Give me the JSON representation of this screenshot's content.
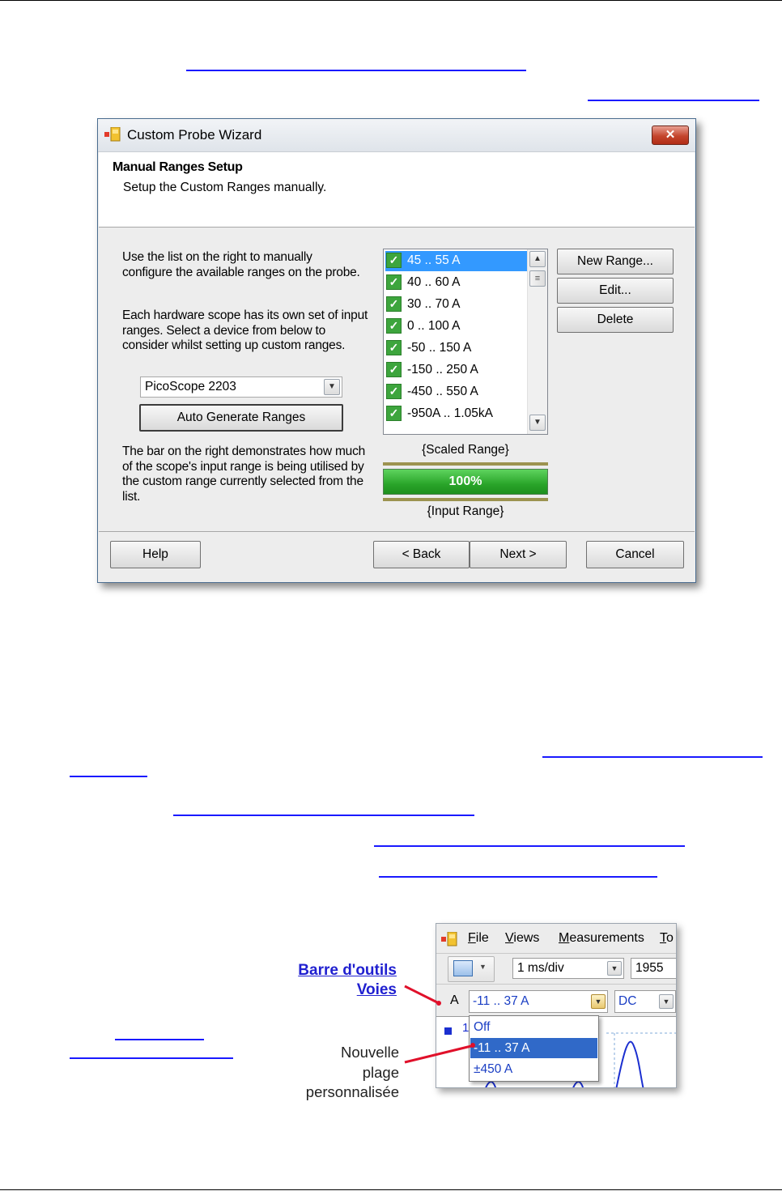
{
  "wizard": {
    "title": "Custom Probe Wizard",
    "close_label": "✕",
    "header_title": "Manual Ranges Setup",
    "header_subtitle": "Setup the Custom Ranges manually.",
    "instructions_1": "Use the list on the right to manually configure the available ranges on the probe.",
    "instructions_2": "Each hardware scope has its own set of input ranges. Select a device from below to consider whilst setting up custom ranges.",
    "device_selected": "PicoScope 2203",
    "auto_generate_label": "Auto Generate Ranges",
    "instructions_3": "The bar on the right demonstrates how much of the scope's input range is being utilised by the custom range currently selected from the list.",
    "ranges": [
      {
        "label": "45 .. 55 A",
        "checked": true,
        "selected": true
      },
      {
        "label": "40 .. 60 A",
        "checked": true,
        "selected": false
      },
      {
        "label": "30 .. 70 A",
        "checked": true,
        "selected": false
      },
      {
        "label": "0 .. 100 A",
        "checked": true,
        "selected": false
      },
      {
        "label": "-50 .. 150 A",
        "checked": true,
        "selected": false
      },
      {
        "label": "-150 .. 250 A",
        "checked": true,
        "selected": false
      },
      {
        "label": "-450 .. 550 A",
        "checked": true,
        "selected": false
      },
      {
        "label": "-950A .. 1.05kA",
        "checked": true,
        "selected": false
      }
    ],
    "new_range_label": "New Range...",
    "edit_label": "Edit...",
    "delete_label": "Delete",
    "scaled_range_label": "{Scaled Range}",
    "utilisation_text": "100%",
    "utilisation_value": 1.0,
    "input_range_label": "{Input Range}",
    "help_label": "Help",
    "back_label": "< Back",
    "next_label": "Next >",
    "cancel_label": "Cancel"
  },
  "picoscope": {
    "menu": [
      {
        "underline": "F",
        "rest": "ile"
      },
      {
        "underline": "V",
        "rest": "iews"
      },
      {
        "underline": "M",
        "rest": "easurements"
      },
      {
        "underline": "T",
        "rest": "o"
      }
    ],
    "timebase": "1 ms/div",
    "samples": "1955",
    "channel_letter": "A",
    "range_selected": "-11 .. 37 A",
    "coupling": "DC",
    "range_options": [
      "Off",
      "-11 .. 37 A",
      "±450 A"
    ],
    "range_options_selected": "-11 .. 37 A",
    "scope_channel_number": "1"
  },
  "annotations": {
    "toolbar_link_line1": "Barre d'outils",
    "toolbar_link_line2": "Voies",
    "new_range_line1": "Nouvelle",
    "new_range_line2": "plage",
    "new_range_line3": "personnalisée"
  },
  "colors": {
    "link_blue": "#1a1aff",
    "selection_blue": "#3399ff",
    "check_green": "#3da53d",
    "bar_green": "#2aa52a",
    "arrow_red": "#e0102a"
  }
}
